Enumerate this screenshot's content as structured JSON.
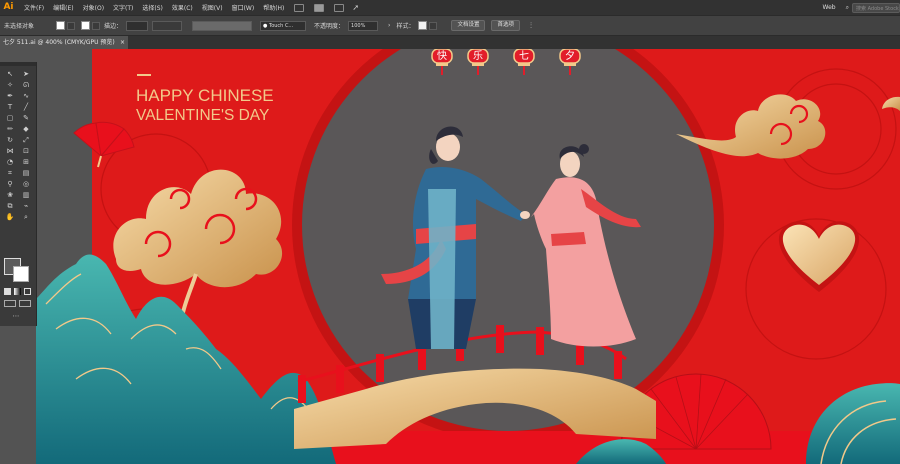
{
  "app": {
    "logo": "Ai"
  },
  "menu": [
    "文件(F)",
    "编辑(E)",
    "对象(O)",
    "文字(T)",
    "选择(S)",
    "效果(C)",
    "视图(V)",
    "窗口(W)",
    "帮助(H)"
  ],
  "menubar_right": {
    "workspace": "Web",
    "search_placeholder": "搜索 Adobe Stock"
  },
  "controlbar": {
    "selection_label": "未选择对象",
    "stroke_label": "描边：",
    "brush_value": "Touch C...",
    "opacity_label": "不透明度：",
    "opacity_value": "100%",
    "style_label": "样式：",
    "doc_setup_button": "文档设置",
    "preferences_button": "首选项"
  },
  "document_tab": {
    "title": "七夕 511.ai @ 400% (CMYK/GPU 预览)",
    "close": "×"
  },
  "artwork": {
    "title_line1": "HAPPY CHINESE",
    "title_line2": "VALENTINE'S DAY",
    "lanterns": [
      "快",
      "乐",
      "七",
      "夕"
    ]
  },
  "colors": {
    "red": "#de1a1a",
    "gold": "#f2c98a",
    "moon": "#5a5758",
    "teal": "#1f8a8c"
  }
}
